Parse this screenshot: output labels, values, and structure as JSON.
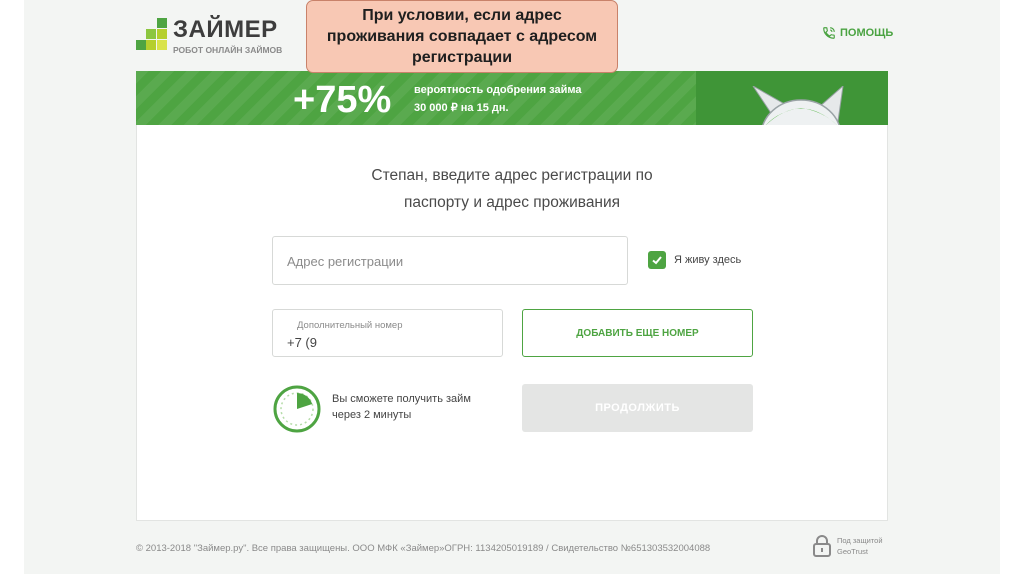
{
  "brand": {
    "name": "ЗАЙМЕР",
    "tagline": "РОБОТ ОНЛАЙН ЗАЙМОВ",
    "colors": {
      "green": "#4ea442",
      "dark_green": "#3f9537",
      "lime": "#b5cf2d"
    }
  },
  "header": {
    "help_label": "ПОМОЩЬ",
    "help_icon": "phone-icon"
  },
  "callout": {
    "lines": [
      "При условии, если адрес",
      "проживания совпадает с адресом",
      "регистрации"
    ]
  },
  "banner": {
    "percent": "+75%",
    "line1": "вероятность одобрения займа",
    "line2": "30 000 ₽ на 15 дн."
  },
  "form": {
    "heading_line1": "Степан, введите адрес регистрации по",
    "heading_line2": "паспорту и адрес проживания",
    "address_placeholder": "Адрес регистрации",
    "live_here_label": "Я живу здесь",
    "live_here_checked": true,
    "extra_phone_label": "Дополнительный номер",
    "extra_phone_value": "+7 (9",
    "add_number_button": "ДОБАВИТЬ ЕЩЕ НОМЕР",
    "continue_button": "ПРОДОЛЖИТЬ",
    "timer_line1": "Вы сможете получить займ",
    "timer_line2": "через 2 минуты"
  },
  "footer": {
    "copyright": "© 2013-2018 \"Займер.ру\". Все права защищены. ООО МФК «Займер»ОГРН: 1134205019189 / Свидетельство №651303532004088",
    "secure_line1": "Под защитой",
    "secure_line2": "GeoTrust"
  }
}
